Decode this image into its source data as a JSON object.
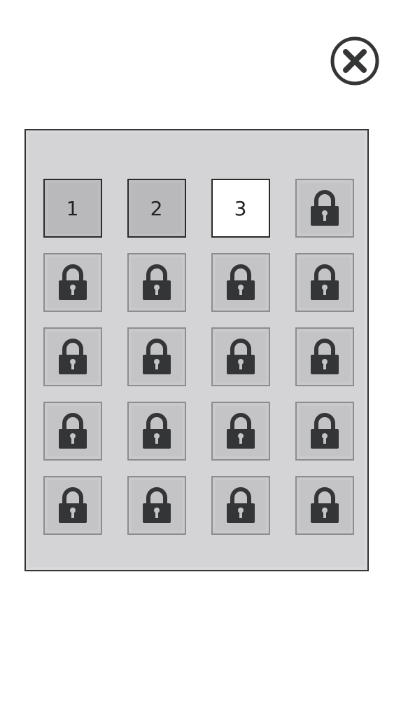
{
  "close_icon": "close-circle-x-icon",
  "lock_icon": "padlock-icon",
  "colors": {
    "icon_dark": "#333537",
    "panel_bg": "#d4d4d7",
    "current_tile_bg": "#ffffff",
    "unlocked_tile_bg": "#b9b9bb",
    "locked_tile_bg": "#c4c4c7"
  },
  "levels": [
    {
      "label": "1",
      "state": "unlocked"
    },
    {
      "label": "2",
      "state": "unlocked"
    },
    {
      "label": "3",
      "state": "current"
    },
    {
      "label": "",
      "state": "locked"
    },
    {
      "label": "",
      "state": "locked"
    },
    {
      "label": "",
      "state": "locked"
    },
    {
      "label": "",
      "state": "locked"
    },
    {
      "label": "",
      "state": "locked"
    },
    {
      "label": "",
      "state": "locked"
    },
    {
      "label": "",
      "state": "locked"
    },
    {
      "label": "",
      "state": "locked"
    },
    {
      "label": "",
      "state": "locked"
    },
    {
      "label": "",
      "state": "locked"
    },
    {
      "label": "",
      "state": "locked"
    },
    {
      "label": "",
      "state": "locked"
    },
    {
      "label": "",
      "state": "locked"
    },
    {
      "label": "",
      "state": "locked"
    },
    {
      "label": "",
      "state": "locked"
    },
    {
      "label": "",
      "state": "locked"
    },
    {
      "label": "",
      "state": "locked"
    }
  ]
}
